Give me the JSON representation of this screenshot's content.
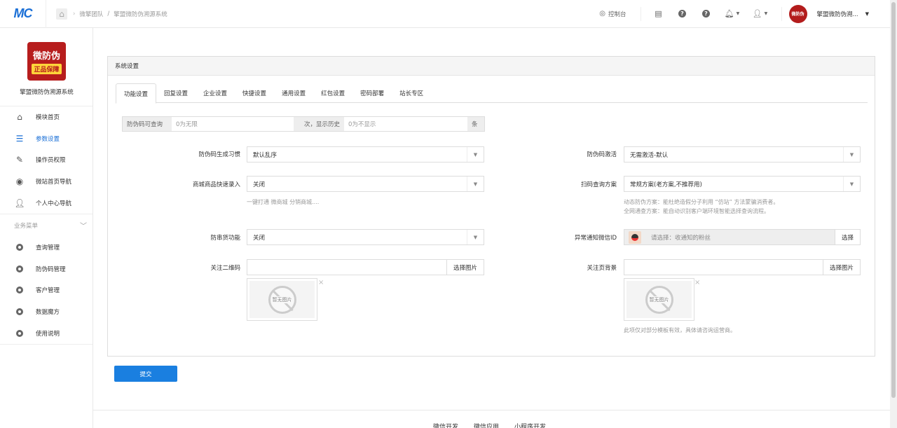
{
  "header": {
    "logo_text": "MC",
    "breadcrumb": [
      "微擎团队",
      "/",
      "擎盟微防伪溯源系统"
    ],
    "console_label": "控制台",
    "avatar_text": "微防伪",
    "username": "擎盟微防伪溯..."
  },
  "sidebar": {
    "brand_line1": "微防伪",
    "brand_line2": "正品保障",
    "brand_name": "擎盟微防伪溯源系统",
    "items": [
      {
        "label": "模块首页",
        "icon": "home-icon"
      },
      {
        "label": "参数设置",
        "icon": "list-icon",
        "active": true
      },
      {
        "label": "操作员权限",
        "icon": "edit-icon"
      },
      {
        "label": "微站首页导航",
        "icon": "globe-icon"
      },
      {
        "label": "个人中心导航",
        "icon": "user-icon"
      }
    ],
    "group_title": "业务菜单",
    "group_items": [
      {
        "label": "查询管理",
        "icon": "gear-icon"
      },
      {
        "label": "防伪码管理",
        "icon": "gear-icon"
      },
      {
        "label": "客户管理",
        "icon": "gear-icon"
      },
      {
        "label": "数据魔方",
        "icon": "gear-icon"
      },
      {
        "label": "使用说明",
        "icon": "gear-icon"
      }
    ]
  },
  "panel": {
    "title": "系统设置",
    "tabs": [
      "功能设置",
      "回复设置",
      "企业设置",
      "快捷设置",
      "通用设置",
      "红包设置",
      "密码部署",
      "站长专区"
    ],
    "query_row": {
      "addon1": "防伪码可查询",
      "placeholder1": "0为无限",
      "addon2": "次，显示历史",
      "placeholder2": "0为不显示",
      "addon3": "条"
    },
    "code_rule": {
      "label": "防伪码生成习惯",
      "value": "默认乱序"
    },
    "activation": {
      "label": "防伪码激活",
      "value": "无需激活-默认"
    },
    "quick_entry": {
      "label": "商城商品快速录入",
      "value": "关闭",
      "help": "一键打通 微商城 分销商城...."
    },
    "scan_plan": {
      "label": "扫码查询方案",
      "value": "常规方案(老方案,不推荐用)",
      "help1": "动态防伪方案：能杜绝造假分子利用 “仿站” 方法蒙骗消费者。",
      "help2": "全网通查方案：能自动识别客户端环境智能选择查询流程。"
    },
    "anti_channel": {
      "label": "防串货功能",
      "value": "关闭"
    },
    "notify_openid": {
      "label": "异常通知微信ID",
      "placeholder": "请选择：收通知的粉丝",
      "button": "选择"
    },
    "qrcode": {
      "label": "关注二维码",
      "button": "选择图片",
      "noimg": "暂无图片"
    },
    "bg": {
      "label": "关注页背景",
      "button": "选择图片",
      "noimg": "暂无图片",
      "help": "此项仅对部分模板有效，具体请咨询运营商。"
    }
  },
  "submit_label": "提交",
  "footer_links": [
    "微信开发",
    "微信应用",
    "小程序开发"
  ]
}
